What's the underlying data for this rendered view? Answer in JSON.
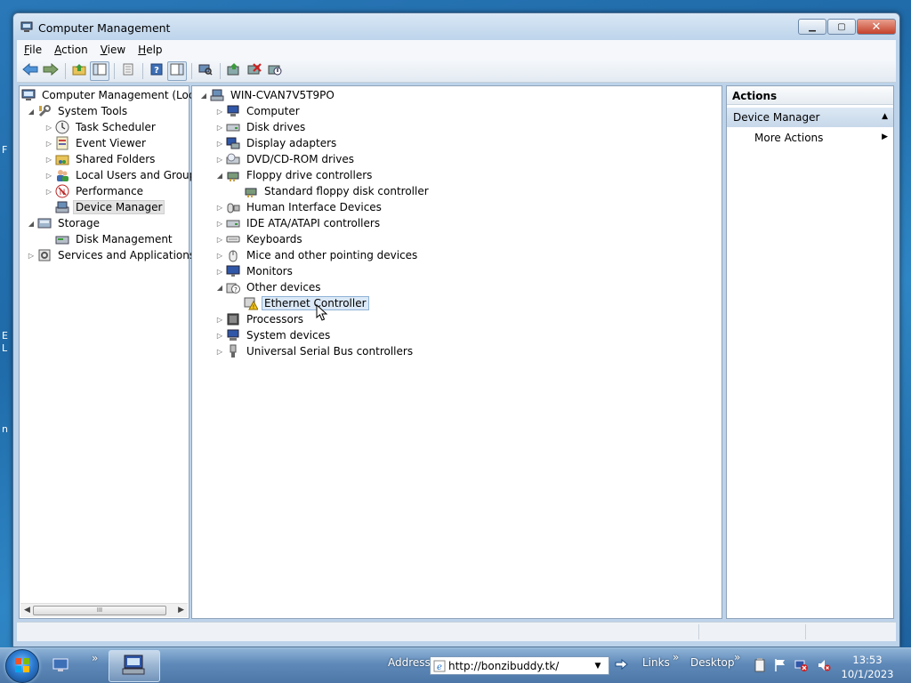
{
  "desktop_fragments": [
    "F",
    "E",
    "L",
    "n"
  ],
  "window": {
    "title": "Computer Management",
    "controls": {
      "minimize": "▁",
      "maximize": "▢",
      "close": "✕"
    }
  },
  "menu": {
    "items": [
      {
        "accel": "F",
        "rest": "ile"
      },
      {
        "accel": "A",
        "rest": "ction"
      },
      {
        "accel": "V",
        "rest": "iew"
      },
      {
        "accel": "H",
        "rest": "elp"
      }
    ]
  },
  "left_tree": {
    "root": "Computer Management (Local",
    "items": [
      {
        "label": "System Tools"
      },
      {
        "label": "Task Scheduler"
      },
      {
        "label": "Event Viewer"
      },
      {
        "label": "Shared Folders"
      },
      {
        "label": "Local Users and Groups"
      },
      {
        "label": "Performance"
      },
      {
        "label": "Device Manager"
      },
      {
        "label": "Storage"
      },
      {
        "label": "Disk Management"
      },
      {
        "label": "Services and Applications"
      }
    ],
    "scrollbar_grip": "III"
  },
  "device_tree": {
    "root": "WIN-CVAN7V5T9PO",
    "items": [
      {
        "label": "Computer"
      },
      {
        "label": "Disk drives"
      },
      {
        "label": "Display adapters"
      },
      {
        "label": "DVD/CD-ROM drives"
      },
      {
        "label": "Floppy drive controllers"
      },
      {
        "label": "Standard floppy disk controller"
      },
      {
        "label": "Human Interface Devices"
      },
      {
        "label": "IDE ATA/ATAPI controllers"
      },
      {
        "label": "Keyboards"
      },
      {
        "label": "Mice and other pointing devices"
      },
      {
        "label": "Monitors"
      },
      {
        "label": "Other devices"
      },
      {
        "label": "Ethernet Controller"
      },
      {
        "label": "Processors"
      },
      {
        "label": "System devices"
      },
      {
        "label": "Universal Serial Bus controllers"
      }
    ]
  },
  "actions": {
    "header": "Actions",
    "section": "Device Manager",
    "more": "More Actions"
  },
  "taskbar": {
    "address_label": "Address",
    "address_value": "http://bonzibuddy.tk/",
    "links_label": "Links",
    "desktop_label": "Desktop",
    "chevron": "»",
    "time": "13:53",
    "date": "10/1/2023"
  },
  "colors": {
    "selection": "#dbe9f7",
    "titlebar": "#bdd4eb",
    "taskbar": "#5e89b8"
  }
}
